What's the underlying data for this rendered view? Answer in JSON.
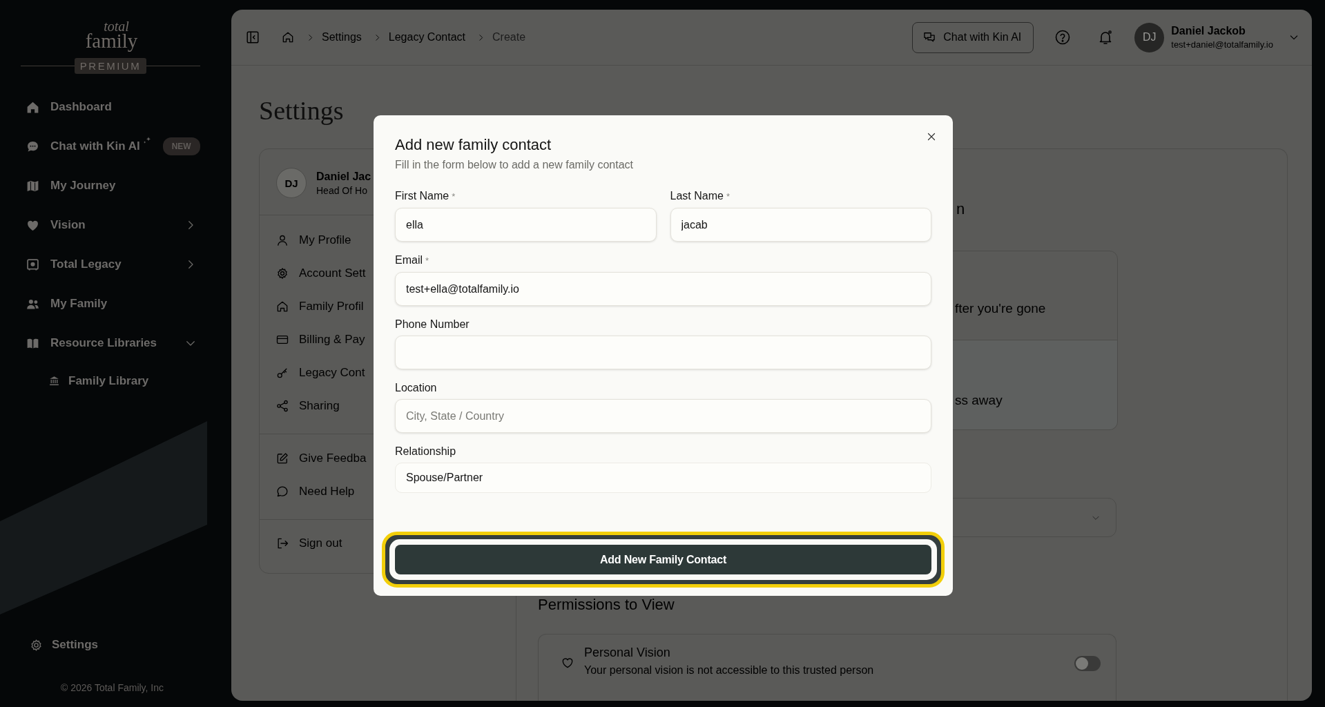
{
  "sidebar": {
    "logo": {
      "top": "total",
      "bottom": "family"
    },
    "plan_badge": "PREMIUM",
    "items": [
      {
        "label": "Dashboard"
      },
      {
        "label": "Chat with Kin AI",
        "badge": "NEW"
      },
      {
        "label": "My Journey"
      },
      {
        "label": "Vision",
        "expanded": false
      },
      {
        "label": "Total Legacy",
        "expanded": false
      },
      {
        "label": "My Family"
      },
      {
        "label": "Resource Libraries",
        "expanded": true,
        "children": [
          {
            "label": "Family Library"
          }
        ]
      }
    ],
    "settings_item": "Settings",
    "copyright": "© 2026 Total Family, Inc"
  },
  "topbar": {
    "breadcrumbs": [
      {
        "label": "Settings",
        "current": false
      },
      {
        "label": "Legacy Contact",
        "current": false
      },
      {
        "label": "Create",
        "current": true
      }
    ],
    "chat_button": "Chat with Kin AI",
    "notification_dot": true,
    "user": {
      "initials": "DJ",
      "name": "Daniel Jackob",
      "email": "test+daniel@totalfamily.io"
    }
  },
  "page": {
    "title": "Settings",
    "profile": {
      "initials": "DJ",
      "name": "Daniel Jac",
      "role": "Head Of Ho"
    },
    "menu_groups": [
      [
        {
          "label": "My Profile"
        },
        {
          "label": "Account Sett"
        },
        {
          "label": "Family Profil"
        },
        {
          "label": "Billing & Pay"
        },
        {
          "label": "Legacy Cont"
        },
        {
          "label": "Sharing"
        }
      ],
      [
        {
          "label": "Give Feedba"
        },
        {
          "label": "Need Help"
        }
      ],
      [
        {
          "label": "Sign out"
        }
      ]
    ],
    "detail": {
      "heading": "n",
      "options": [
        {
          "text": "fter you're gone"
        },
        {
          "text": "ss away"
        }
      ],
      "permissions_title": "Permissions to View",
      "permissions": [
        {
          "title": "Personal Vision",
          "description": "Your personal vision is not accessible to this trusted person",
          "on": false
        }
      ]
    }
  },
  "modal": {
    "title": "Add new family contact",
    "subtitle": "Fill in the form below to add a new family contact",
    "rows": [
      [
        {
          "label": "First Name",
          "required_mark": "*",
          "kind": "text",
          "value": "ella"
        },
        {
          "label": "Last Name",
          "required_mark": "*",
          "kind": "text",
          "value": "jacab"
        }
      ],
      [
        {
          "label": "Email",
          "required_mark": "*",
          "kind": "text",
          "value": "test+ella@totalfamily.io"
        }
      ],
      [
        {
          "label": "Phone Number",
          "kind": "text"
        }
      ],
      [
        {
          "label": "Location",
          "kind": "text",
          "placeholder": "City, State / Country"
        }
      ],
      [
        {
          "label": "Relationship",
          "kind": "select",
          "value": "Spouse/Partner"
        }
      ]
    ],
    "submit": {
      "label": "Add New Family Contact",
      "focused": true
    }
  }
}
